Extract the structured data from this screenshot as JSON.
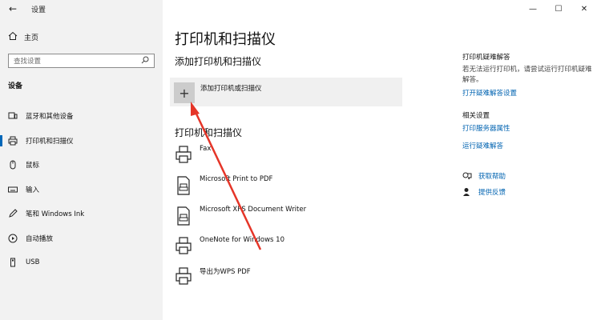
{
  "window": {
    "app_title": "设置",
    "minimize": "—",
    "maximize": "☐",
    "close": "✕"
  },
  "sidebar": {
    "home": "主页",
    "search_placeholder": "查找设置",
    "section": "设备",
    "items": [
      {
        "label": "蓝牙和其他设备",
        "icon": "bluetooth-devices-icon"
      },
      {
        "label": "打印机和扫描仪",
        "icon": "printer-icon"
      },
      {
        "label": "鼠标",
        "icon": "mouse-icon"
      },
      {
        "label": "输入",
        "icon": "keyboard-icon"
      },
      {
        "label": "笔和 Windows Ink",
        "icon": "pen-icon"
      },
      {
        "label": "自动播放",
        "icon": "autoplay-icon"
      },
      {
        "label": "USB",
        "icon": "usb-icon"
      }
    ],
    "active_index": 1
  },
  "main": {
    "title": "打印机和扫描仪",
    "add_section_title": "添加打印机和扫描仪",
    "add_button_label": "添加打印机或扫描仪",
    "list_title": "打印机和扫描仪",
    "printers": [
      {
        "name": "Fax",
        "icon": "fax-icon"
      },
      {
        "name": "Microsoft Print to PDF",
        "icon": "pdf-printer-icon"
      },
      {
        "name": "Microsoft XPS Document Writer",
        "icon": "xps-printer-icon"
      },
      {
        "name": "OneNote for Windows 10",
        "icon": "onenote-printer-icon"
      },
      {
        "name": "导出为WPS PDF",
        "icon": "printer-icon"
      }
    ]
  },
  "right_panel": {
    "troubleshoot_title": "打印机疑难解答",
    "troubleshoot_text": "若无法运行打印机，请尝试运行打印机疑难解答。",
    "troubleshoot_link": "打开疑难解答设置",
    "related_title": "相关设置",
    "related_links": [
      "打印服务器属性",
      "运行疑难解答"
    ],
    "help": [
      {
        "label": "获取帮助",
        "icon": "help-chat-icon"
      },
      {
        "label": "提供反馈",
        "icon": "feedback-icon"
      }
    ]
  },
  "colors": {
    "sidebar_bg": "#f2f2f2",
    "accent": "#0067b8",
    "link": "#0063b1",
    "annotation_arrow": "#e53528"
  }
}
